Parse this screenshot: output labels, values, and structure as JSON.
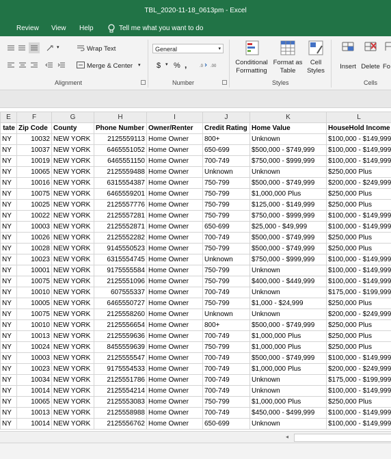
{
  "window": {
    "title": "TBL_2020-11-18_0613pm  -  Excel"
  },
  "tabs": [
    "Review",
    "View",
    "Help"
  ],
  "tell_me": "Tell me what you want to do",
  "ribbon": {
    "wrap_text": "Wrap Text",
    "merge_center": "Merge & Center",
    "number_format": "General",
    "currency": "$",
    "percent": "%",
    "comma": ",",
    "conditional_formatting": [
      "Conditional",
      "Formatting"
    ],
    "format_as_table": [
      "Format as",
      "Table"
    ],
    "cell_styles": [
      "Cell",
      "Styles"
    ],
    "insert": "Insert",
    "delete": "Delete",
    "format_partial": "Fo",
    "groups": {
      "alignment": "Alignment",
      "number": "Number",
      "styles": "Styles",
      "cells": "Cells"
    }
  },
  "sheet": {
    "column_letters": [
      "E",
      "F",
      "G",
      "H",
      "I",
      "J",
      "K",
      "L"
    ],
    "headers": [
      "tate",
      "Zip Code",
      "County",
      "Phone Number",
      "Owner/Renter",
      "Credit Rating",
      "Home Value",
      "HouseHold Income"
    ],
    "rows": [
      [
        "NY",
        "10032",
        "NEW YORK",
        "2125559113",
        "Home Owner",
        "800+",
        "Unknown",
        "$100,000 - $149,999"
      ],
      [
        "NY",
        "10037",
        "NEW YORK",
        "6465551052",
        "Home Owner",
        "650-699",
        "$500,000 - $749,999",
        "$100,000 - $149,999"
      ],
      [
        "NY",
        "10019",
        "NEW YORK",
        "6465551150",
        "Home Owner",
        "700-749",
        "$750,000 - $999,999",
        "$100,000 - $149,999"
      ],
      [
        "NY",
        "10065",
        "NEW YORK",
        "2125559488",
        "Home Owner",
        "Unknown",
        "Unknown",
        "$250,000 Plus"
      ],
      [
        "NY",
        "10016",
        "NEW YORK",
        "6315554387",
        "Home Owner",
        "750-799",
        "$500,000 - $749,999",
        "$200,000 - $249,999"
      ],
      [
        "NY",
        "10075",
        "NEW YORK",
        "6465559201",
        "Home Owner",
        "750-799",
        "$1,000,000 Plus",
        "$250,000 Plus"
      ],
      [
        "NY",
        "10025",
        "NEW YORK",
        "2125557776",
        "Home Owner",
        "750-799",
        "$125,000 - $149,999",
        "$250,000 Plus"
      ],
      [
        "NY",
        "10022",
        "NEW YORK",
        "2125557281",
        "Home Owner",
        "750-799",
        "$750,000 - $999,999",
        "$100,000 - $149,999"
      ],
      [
        "NY",
        "10003",
        "NEW YORK",
        "2125552871",
        "Home Owner",
        "650-699",
        "$25,000 - $49,999",
        "$100,000 - $149,999"
      ],
      [
        "NY",
        "10026",
        "NEW YORK",
        "2125552282",
        "Home Owner",
        "700-749",
        "$500,000 - $749,999",
        "$250,000 Plus"
      ],
      [
        "NY",
        "10028",
        "NEW YORK",
        "9145550523",
        "Home Owner",
        "750-799",
        "$500,000 - $749,999",
        "$250,000 Plus"
      ],
      [
        "NY",
        "10023",
        "NEW YORK",
        "6315554745",
        "Home Owner",
        "Unknown",
        "$750,000 - $999,999",
        "$100,000 - $149,999"
      ],
      [
        "NY",
        "10001",
        "NEW YORK",
        "9175555584",
        "Home Owner",
        "750-799",
        "Unknown",
        "$100,000 - $149,999"
      ],
      [
        "NY",
        "10075",
        "NEW YORK",
        "2125551096",
        "Home Owner",
        "750-799",
        "$400,000 - $449,999",
        "$100,000 - $149,999"
      ],
      [
        "NY",
        "10010",
        "NEW YORK",
        "607555337",
        "Home Owner",
        "700-749",
        "Unknown",
        "$175,000 - $199,999"
      ],
      [
        "NY",
        "10005",
        "NEW YORK",
        "6465550727",
        "Home Owner",
        "750-799",
        "$1,000 - $24,999",
        "$250,000 Plus"
      ],
      [
        "NY",
        "10075",
        "NEW YORK",
        "2125558260",
        "Home Owner",
        "Unknown",
        "Unknown",
        "$200,000 - $249,999"
      ],
      [
        "NY",
        "10010",
        "NEW YORK",
        "2125556654",
        "Home Owner",
        "800+",
        "$500,000 - $749,999",
        "$250,000 Plus"
      ],
      [
        "NY",
        "10013",
        "NEW YORK",
        "2125559636",
        "Home Owner",
        "700-749",
        "$1,000,000 Plus",
        "$250,000 Plus"
      ],
      [
        "NY",
        "10024",
        "NEW YORK",
        "8455559639",
        "Home Owner",
        "750-799",
        "$1,000,000 Plus",
        "$250,000 Plus"
      ],
      [
        "NY",
        "10003",
        "NEW YORK",
        "2125555547",
        "Home Owner",
        "700-749",
        "$500,000 - $749,999",
        "$100,000 - $149,999"
      ],
      [
        "NY",
        "10023",
        "NEW YORK",
        "9175554533",
        "Home Owner",
        "700-749",
        "$1,000,000 Plus",
        "$200,000 - $249,999"
      ],
      [
        "NY",
        "10034",
        "NEW YORK",
        "2125551786",
        "Home Owner",
        "700-749",
        "Unknown",
        "$175,000 - $199,999"
      ],
      [
        "NY",
        "10014",
        "NEW YORK",
        "2125554214",
        "Home Owner",
        "700-749",
        "Unknown",
        "$100,000 - $149,999"
      ],
      [
        "NY",
        "10065",
        "NEW YORK",
        "2125553083",
        "Home Owner",
        "750-799",
        "$1,000,000 Plus",
        "$250,000 Plus"
      ],
      [
        "NY",
        "10013",
        "NEW YORK",
        "2125558988",
        "Home Owner",
        "700-749",
        "$450,000 - $499,999",
        "$100,000 - $149,999"
      ],
      [
        "NY",
        "10014",
        "NEW YORK",
        "2125556762",
        "Home Owner",
        "650-699",
        "Unknown",
        "$100,000 - $149,999"
      ]
    ]
  },
  "scroll_left_glyph": "◂",
  "colors": {
    "excel_green": "#217346",
    "ribbon_bg": "#f3f3f3",
    "gridline": "#d4d4d4"
  }
}
